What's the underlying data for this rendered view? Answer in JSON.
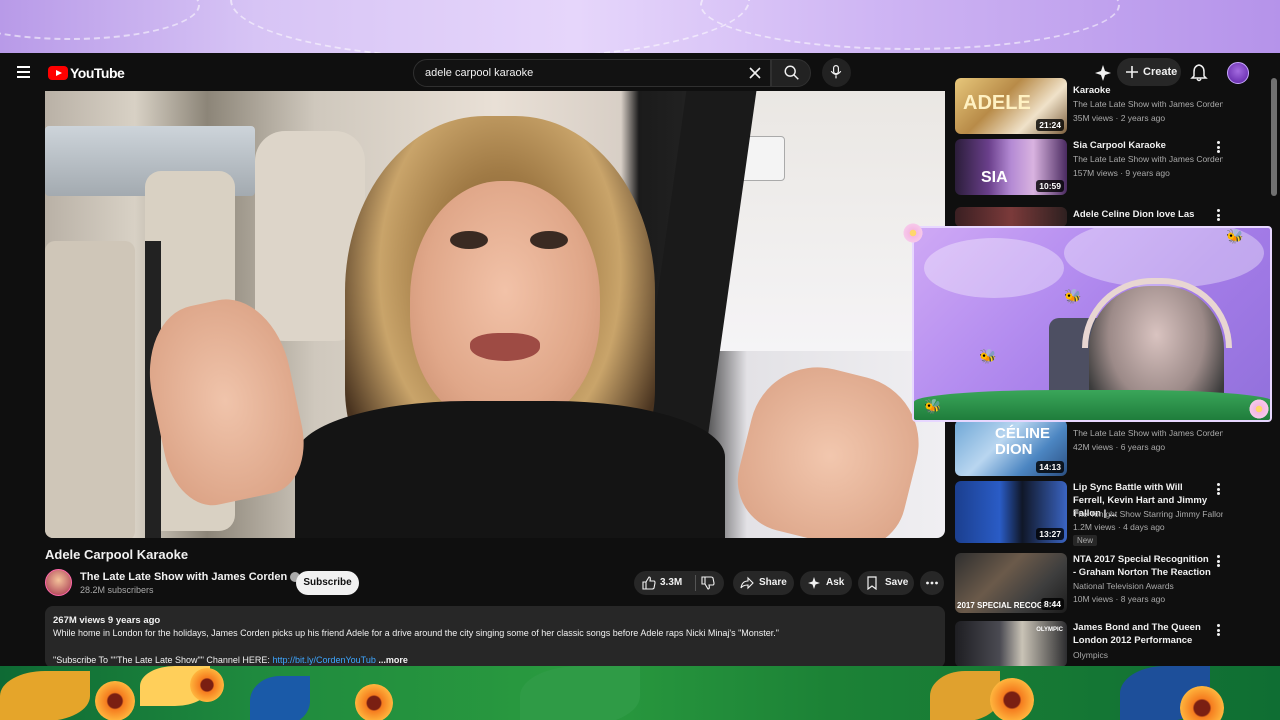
{
  "header": {
    "logo_text": "YouTube",
    "search_query": "adele carpool karaoke",
    "create_label": "Create"
  },
  "video": {
    "title": "Adele Carpool Karaoke",
    "channel": "The Late Late Show with James Corden",
    "subscribers": "28.2M subscribers",
    "subscribe_label": "Subscribe",
    "likes": "3.3M",
    "share_label": "Share",
    "ask_label": "Ask",
    "save_label": "Save",
    "meta": "267M views  9 years ago",
    "description_line1": "While home in London for the holidays, James Corden picks up his friend Adele for a drive around the city singing some of her classic songs before Adele raps Nicki Minaj's \"Monster.\"",
    "description_line2_prefix": "\"Subscribe To \"\"The Late Late Show\"\" Channel HERE: ",
    "description_link": "http://bit.ly/CordenYouTub",
    "more_label": "...more"
  },
  "recommendations": [
    {
      "title": "Karaoke",
      "channel": "The Late Late Show with James Corden...",
      "views": "35M views · 2 years ago",
      "duration": "21:24",
      "thumb_text": "ADELE"
    },
    {
      "title": "Sia Carpool Karaoke",
      "channel": "The Late Late Show with James Corden...",
      "views": "157M views · 9 years ago",
      "duration": "10:59",
      "thumb_text": "SIA"
    },
    {
      "title": "Adele Celine Dion love Las",
      "channel": "",
      "views": "",
      "duration": "",
      "thumb_text": ""
    },
    {
      "title": "",
      "channel": "The Late Late Show with James Corden...",
      "views": "42M views · 6 years ago",
      "duration": "14:13",
      "thumb_text": "CÉLINE DION"
    },
    {
      "title": "Lip Sync Battle with Will Ferrell, Kevin Hart and Jimmy Fallon | ...",
      "channel": "The Tonight Show Starring Jimmy Fallon...",
      "views": "1.2M views · 4 days ago",
      "duration": "13:27",
      "badge": "New",
      "thumb_text": ""
    },
    {
      "title": "NTA 2017  Special Recognition - Graham Norton The Reaction",
      "channel": "National Television Awards",
      "views": "10M views · 8 years ago",
      "duration": "8:44",
      "thumb_text": "2017 SPECIAL RECOGNIT"
    },
    {
      "title": "James Bond and The Queen London 2012 Performance",
      "channel": "Olympics",
      "views": "",
      "duration": "",
      "thumb_text": "OLYMPIC"
    }
  ],
  "colors": {
    "background": "#0f0f0f",
    "accent_red": "#ff0000",
    "overlay_purple": "#b89ae8",
    "overlay_green": "#1f8a3e"
  }
}
